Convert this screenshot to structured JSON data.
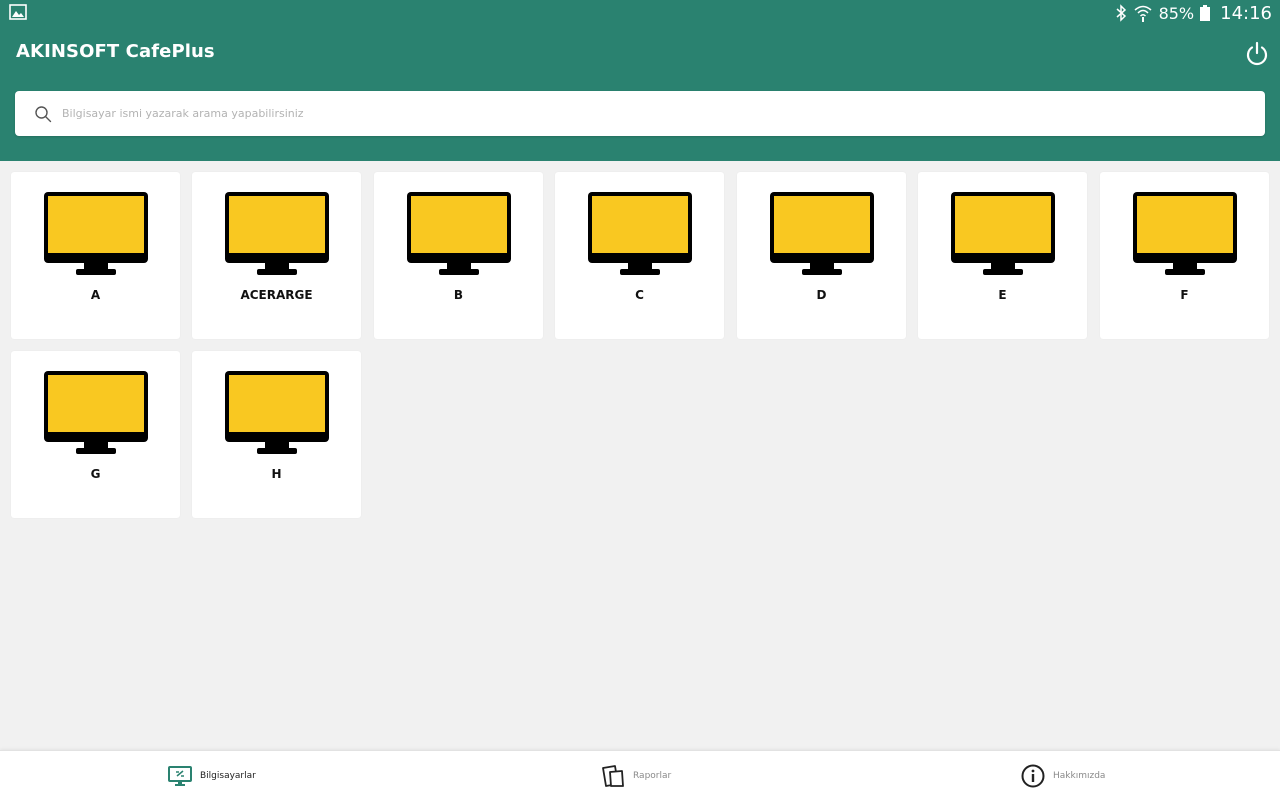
{
  "status_bar": {
    "battery": "85%",
    "time": "14:16",
    "icons": [
      "gallery-icon",
      "bluetooth-icon",
      "wifi-icon",
      "battery-icon"
    ]
  },
  "header": {
    "title": "AKINSOFT CafePlus",
    "power_icon": "power-icon"
  },
  "search": {
    "placeholder": "Bilgisayar ismi yazarak arama yapabilirsiniz",
    "value": ""
  },
  "computers": [
    {
      "name": "A"
    },
    {
      "name": "ACERARGE"
    },
    {
      "name": "B"
    },
    {
      "name": "C"
    },
    {
      "name": "D"
    },
    {
      "name": "E"
    },
    {
      "name": "F"
    },
    {
      "name": "G"
    },
    {
      "name": "H"
    }
  ],
  "bottom_nav": {
    "items": [
      {
        "label": "Bilgisayarlar",
        "icon": "computers-icon",
        "active": true
      },
      {
        "label": "Raporlar",
        "icon": "reports-icon",
        "active": false
      },
      {
        "label": "Hakkımızda",
        "icon": "info-icon",
        "active": false
      }
    ]
  },
  "colors": {
    "primary": "#2a8270",
    "screen": "#f9c821",
    "background": "#f1f1f1"
  }
}
